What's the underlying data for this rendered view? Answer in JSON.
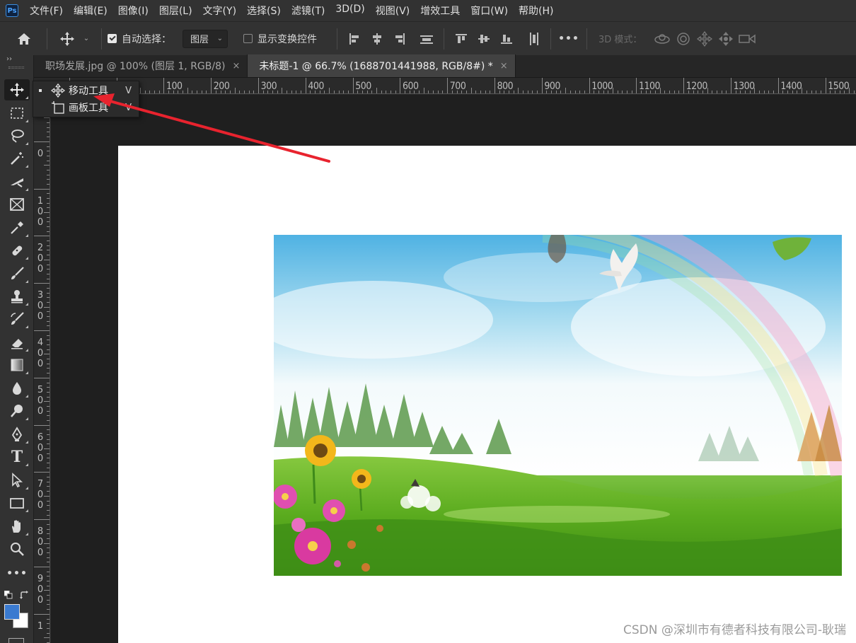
{
  "app": {
    "logo": "Ps"
  },
  "menu": [
    {
      "id": "file",
      "label": "文件(F)"
    },
    {
      "id": "edit",
      "label": "编辑(E)"
    },
    {
      "id": "image",
      "label": "图像(I)"
    },
    {
      "id": "layer",
      "label": "图层(L)"
    },
    {
      "id": "type",
      "label": "文字(Y)"
    },
    {
      "id": "select",
      "label": "选择(S)"
    },
    {
      "id": "filter",
      "label": "滤镜(T)"
    },
    {
      "id": "3d",
      "label": "3D(D)"
    },
    {
      "id": "view",
      "label": "视图(V)"
    },
    {
      "id": "plugins",
      "label": "增效工具"
    },
    {
      "id": "window",
      "label": "窗口(W)"
    },
    {
      "id": "help",
      "label": "帮助(H)"
    }
  ],
  "options_bar": {
    "auto_select_label": "自动选择：",
    "auto_select_checked": true,
    "auto_select_target": "图层",
    "show_transform_label": "显示变换控件",
    "show_transform_checked": false,
    "more_label": "•••",
    "three_d_mode_label": "3D 模式："
  },
  "tabs": [
    {
      "label": "职场发展.jpg @ 100% (图层 1, RGB/8)",
      "close": "×",
      "active": false
    },
    {
      "label": "未标题-1 @ 66.7% (1688701441988, RGB/8#) *",
      "close": "×",
      "active": true
    }
  ],
  "ruler_top": [
    "100",
    "200",
    "300",
    "400",
    "500",
    "600",
    "700",
    "800",
    "900",
    "1000",
    "1100",
    "1200",
    "1300",
    "1400",
    "1500"
  ],
  "ruler_left": [
    "0",
    "0",
    "100",
    "200",
    "300",
    "400",
    "500",
    "600",
    "700",
    "800",
    "900",
    "1"
  ],
  "flyout": [
    {
      "label": "移动工具",
      "shortcut": "V",
      "selected": true,
      "icon": "move-icon"
    },
    {
      "label": "画板工具",
      "shortcut": "V",
      "selected": false,
      "icon": "artboard-icon"
    }
  ],
  "toolbar": {
    "collapse": "››",
    "type_tool_glyph": "T",
    "more_tools": "•••"
  },
  "colors": {
    "foreground": "#3a7ad0",
    "background": "#ffffff",
    "annotation_arrow": "#e8232e"
  },
  "watermark": "CSDN @深圳市有德者科技有限公司-耿瑞"
}
